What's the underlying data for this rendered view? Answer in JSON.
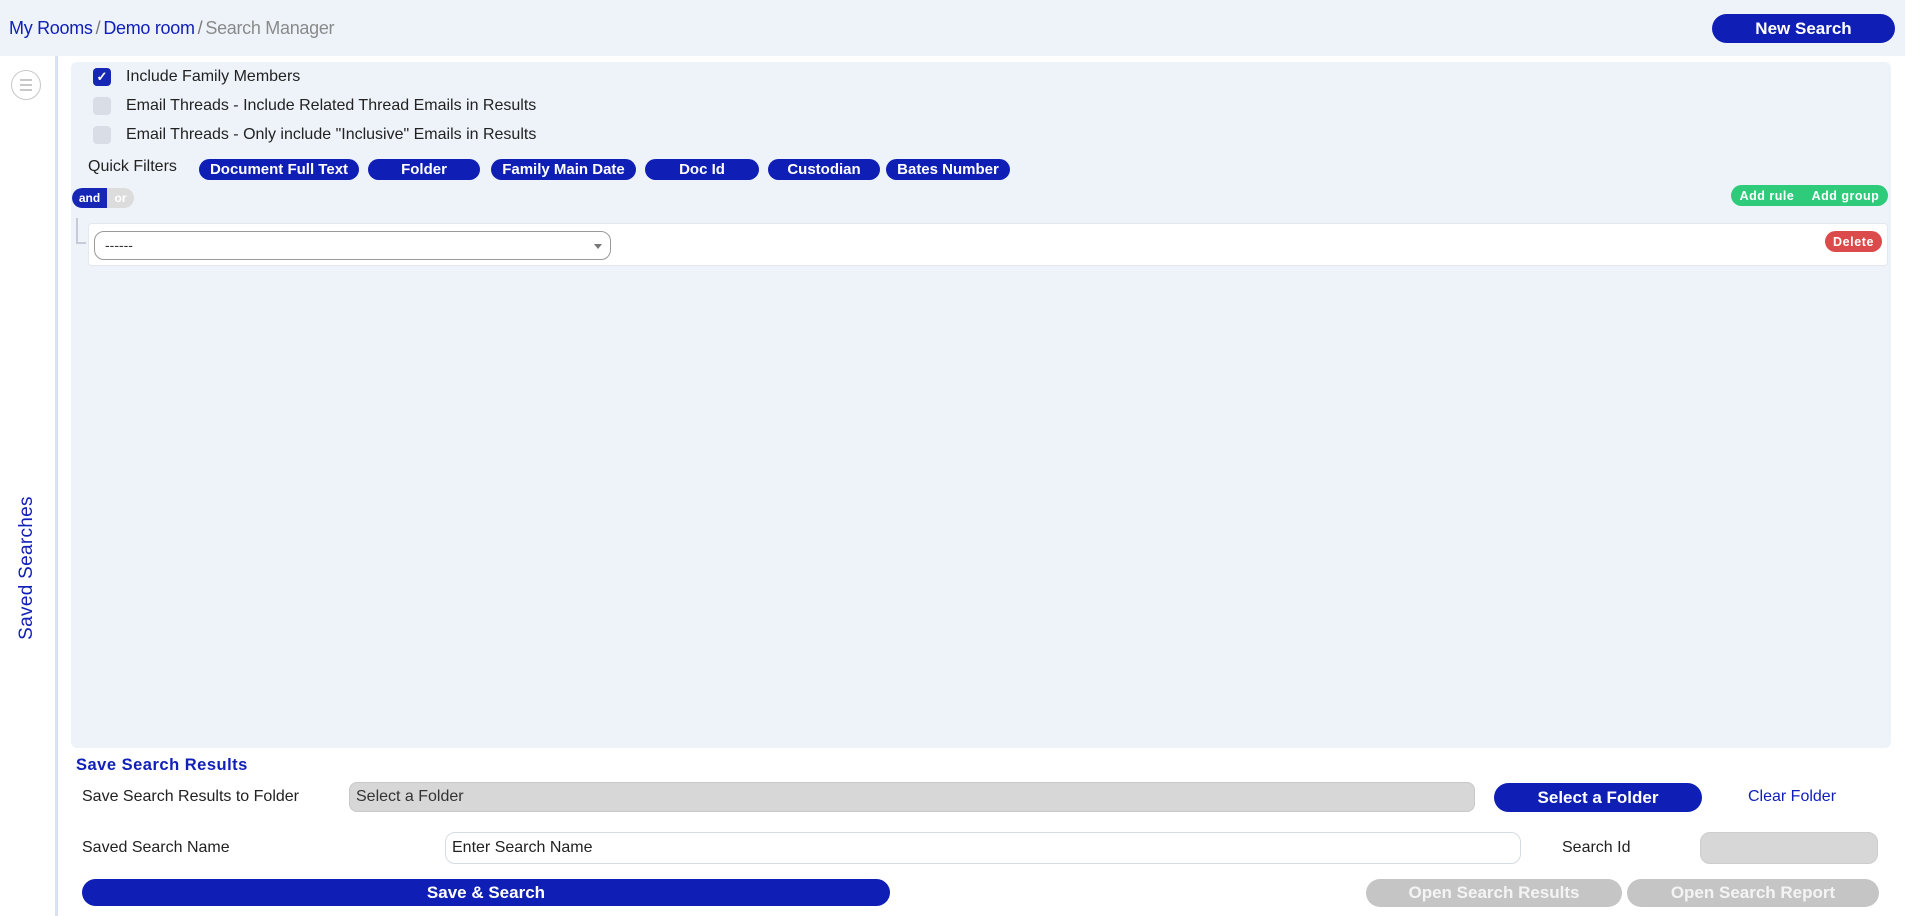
{
  "breadcrumb": {
    "items": [
      "My Rooms",
      "Demo room"
    ],
    "separator": "/",
    "current": "Search Manager"
  },
  "header": {
    "new_search_label": "New Search"
  },
  "sidebar": {
    "menu_icon": "hamburger-circle-icon",
    "saved_searches_label": "Saved Searches"
  },
  "options": [
    {
      "label": "Include Family Members",
      "checked": true
    },
    {
      "label": "Email Threads - Include Related Thread Emails in Results",
      "checked": false
    },
    {
      "label": "Email Threads - Only include \"Inclusive\" Emails in Results",
      "checked": false
    }
  ],
  "quick_filters": {
    "label": "Quick Filters",
    "chips": [
      "Document Full Text",
      "Folder",
      "Family Main Date",
      "Doc Id",
      "Custodian",
      "Bates Number"
    ]
  },
  "query_builder": {
    "condition": {
      "and_label": "and",
      "or_label": "or",
      "selected": "and"
    },
    "add_rule_label": "Add rule",
    "add_group_label": "Add group",
    "rule": {
      "select_value": "------",
      "delete_label": "Delete"
    }
  },
  "save_section": {
    "title": "Save Search Results",
    "folder_label": "Save Search Results to Folder",
    "folder_value": "Select a Folder",
    "select_folder_label": "Select a Folder",
    "clear_folder_label": "Clear Folder",
    "name_label": "Saved Search Name",
    "name_placeholder": "Enter Search Name",
    "search_id_label": "Search Id",
    "search_id_value": "",
    "save_search_label": "Save & Search",
    "open_results_label": "Open Search Results",
    "open_report_label": "Open Search Report"
  },
  "colors": {
    "primary": "#0f1fb5",
    "success": "#2ecb7a",
    "danger": "#dc4b4b",
    "disabled": "#c5c5c5",
    "panel_bg": "#eef3fa"
  }
}
